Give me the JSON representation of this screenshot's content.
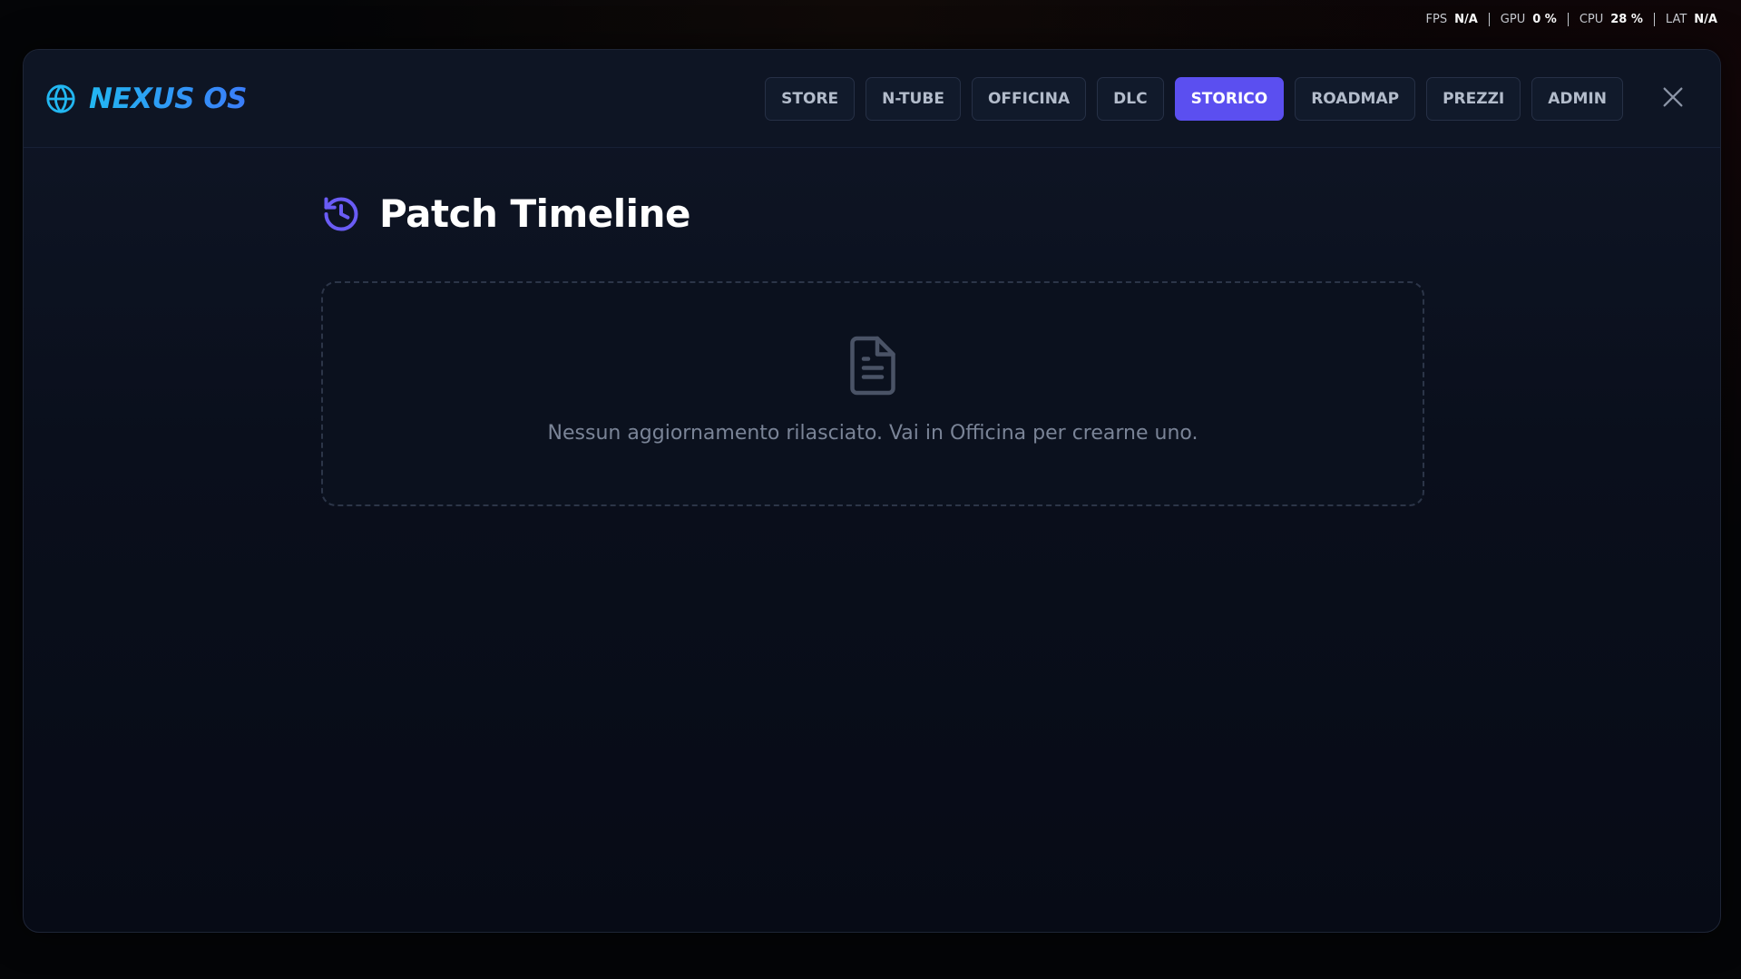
{
  "perf": [
    {
      "label": "FPS",
      "value": "N/A"
    },
    {
      "label": "GPU",
      "value": "0 %"
    },
    {
      "label": "CPU",
      "value": "28 %"
    },
    {
      "label": "LAT",
      "value": "N/A"
    }
  ],
  "brand": {
    "name": "NEXUS OS",
    "icon": "globe-icon"
  },
  "nav": {
    "tabs": [
      {
        "label": "STORE"
      },
      {
        "label": "N-TUBE"
      },
      {
        "label": "OFFICINA"
      },
      {
        "label": "DLC"
      },
      {
        "label": "STORICO",
        "active": true
      },
      {
        "label": "ROADMAP"
      },
      {
        "label": "PREZZI"
      },
      {
        "label": "ADMIN"
      }
    ],
    "close_icon": "close-icon"
  },
  "main": {
    "title": "Patch Timeline",
    "title_icon": "history-icon",
    "empty_state": {
      "icon": "document-icon",
      "message": "Nessun aggiornamento rilasciato. Vai in Officina per crearne uno."
    }
  },
  "colors": {
    "accent": "#5b4ff0",
    "brand_gradient_start": "#22b7f1",
    "brand_gradient_end": "#3b7dfa",
    "background": "#0a0f1c"
  }
}
